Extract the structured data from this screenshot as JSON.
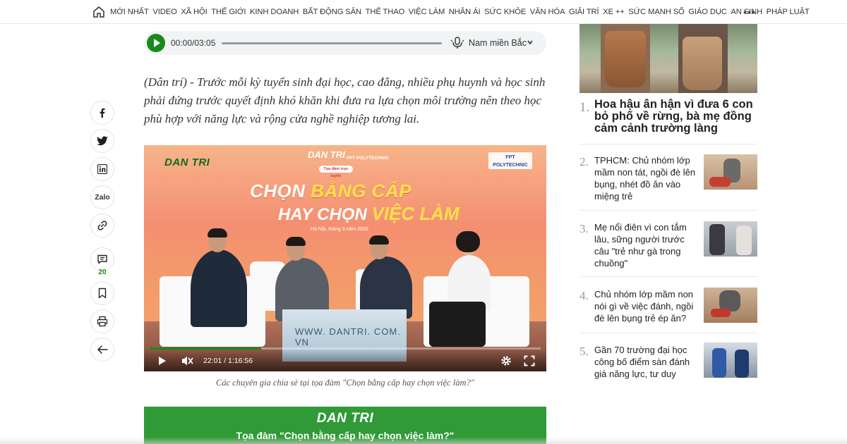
{
  "nav": {
    "items": [
      "MỚI NHẤT",
      "VIDEO",
      "XÃ HỘI",
      "THẾ GIỚI",
      "KINH DOANH",
      "BẤT ĐỘNG SẢN",
      "THỂ THAO",
      "VIỆC LÀM",
      "NHÂN ÁI",
      "SỨC KHỎE",
      "VĂN HÓA",
      "GIẢI TRÍ",
      "XE ++",
      "SỨC MẠNH SỐ",
      "GIÁO DỤC",
      "AN SINH",
      "PHÁP LUẬT"
    ],
    "more": "•••"
  },
  "audio": {
    "time": "00:00/03:05",
    "voice": "Nam miền Bắc",
    "progress": 0
  },
  "share": {
    "zalo": "Zalo",
    "comment_count": "20"
  },
  "article": {
    "lead_source": "(Dân trí)",
    "lead_text": " - Trước mỗi kỳ tuyển sinh đại học, cao đẳng, nhiều phụ huynh và học sinh phải đứng trước quyết định khó khăn khi đưa ra lựa chọn môi trường nên theo học phù hợp với năng lực và rộng cửa nghề nghiệp tương lai.",
    "video": {
      "logo": "DAN TRI",
      "logo_top": "DAN TRI",
      "sponsor": "FPT POLYTECHNIC",
      "tag": "Tọa đàm trực tuyến",
      "title_line1_a": "CHỌN ",
      "title_line1_b": "BẰNG CẤP",
      "title_line2_a": "HAY CHỌN ",
      "title_line2_b": "VIỆC LÀM",
      "date": "Hà Nội, tháng 3 năm 2025",
      "table_text": "WWW. DANTRI. COM. VN",
      "time": "22:01 / 1:16:56",
      "progress": 0.286
    },
    "caption": "Các chuyên gia chia sẻ tại tọa đàm \"Chọn bằng cấp hay chọn việc làm?\"",
    "banner_logo": "DAN TRI",
    "banner_title": "Tọa đàm \"Chọn bằng cấp hay chọn việc làm?\""
  },
  "sidebar": {
    "items": [
      {
        "rank": "1.",
        "title": "Hoa hậu ân hận vì đưa 6 con bỏ phố về rừng, bà mẹ đồng cảm cảnh trường làng"
      },
      {
        "rank": "2.",
        "title": "TPHCM: Chủ nhóm lớp mầm non tát, ngồi đè lên bụng, nhét đồ ăn vào miệng trẻ"
      },
      {
        "rank": "3.",
        "title": "Mẹ nổi điên vì con tắm lâu, sững người trước câu \"trẻ như gà trong chuồng\""
      },
      {
        "rank": "4.",
        "title": "Chủ nhóm lớp mầm non nói gì về việc đánh, ngồi đè lên bụng trẻ ép ăn?"
      },
      {
        "rank": "5.",
        "title": "Gần 70 trường đại học công bố điểm sàn đánh giá năng lực, tư duy"
      }
    ]
  },
  "colors": {
    "accent": "#1a8a1a",
    "banner": "#2f9a36"
  }
}
